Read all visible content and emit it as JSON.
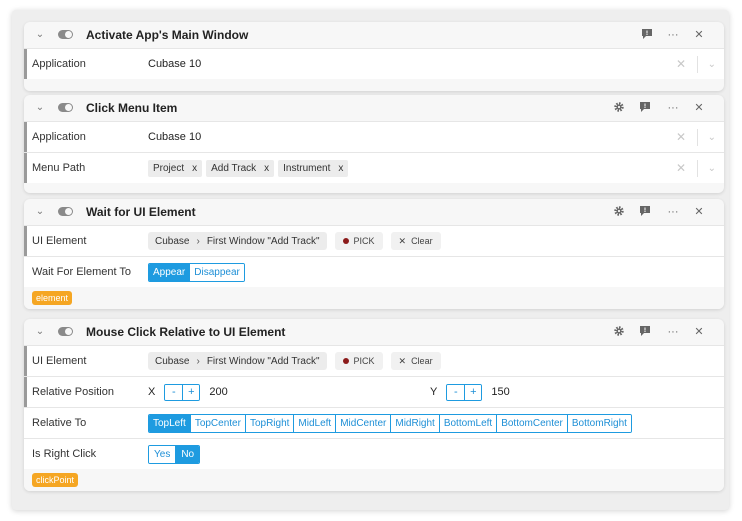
{
  "cards": [
    {
      "title": "Activate App's Main Window",
      "rows": [
        {
          "label": "Application",
          "value": "Cubase 10"
        }
      ]
    },
    {
      "title": "Click Menu Item",
      "rows": [
        {
          "label": "Application",
          "value": "Cubase 10"
        },
        {
          "label": "Menu Path",
          "chips": [
            "Project",
            "Add Track",
            "Instrument"
          ]
        }
      ]
    },
    {
      "title": "Wait for UI Element",
      "rows": [
        {
          "label": "UI Element",
          "path": [
            "Cubase",
            "First Window \"Add Track\""
          ],
          "pick": "PICK",
          "clear": "Clear"
        },
        {
          "label": "Wait For Element To",
          "options": [
            "Appear",
            "Disappear"
          ],
          "selected": "Appear"
        }
      ],
      "tag": "element"
    },
    {
      "title": "Mouse Click Relative to UI Element",
      "rows": [
        {
          "label": "UI Element",
          "path": [
            "Cubase",
            "First Window \"Add Track\""
          ],
          "pick": "PICK",
          "clear": "Clear"
        },
        {
          "label": "Relative Position",
          "x_label": "X",
          "x_value": "200",
          "y_label": "Y",
          "y_value": "150",
          "minus": "-",
          "plus": "+"
        },
        {
          "label": "Relative To",
          "options": [
            "TopLeft",
            "TopCenter",
            "TopRight",
            "MidLeft",
            "MidCenter",
            "MidRight",
            "BottomLeft",
            "BottomCenter",
            "BottomRight"
          ],
          "selected": "TopLeft"
        },
        {
          "label": "Is Right Click",
          "options": [
            "Yes",
            "No"
          ],
          "selected": "No"
        }
      ],
      "tag": "clickPoint"
    }
  ],
  "icons": {
    "collapse": "chevron-down-icon",
    "toggle": "toggle-switch-icon",
    "settings": "gear-icon",
    "comment": "comment-icon",
    "more": "more-icon",
    "close": "close-icon",
    "clear": "clear-icon",
    "dropdown": "chevron-down-icon"
  },
  "glyphs": {
    "close": "✕",
    "more": "···",
    "chevron": "⌄",
    "breadcrumb_sep": "›",
    "chip_remove": "x",
    "clear_pick": "✕"
  },
  "colors": {
    "accent": "#1e9be0",
    "tag": "#f5a623",
    "pick_dot": "#8b1a1a"
  }
}
